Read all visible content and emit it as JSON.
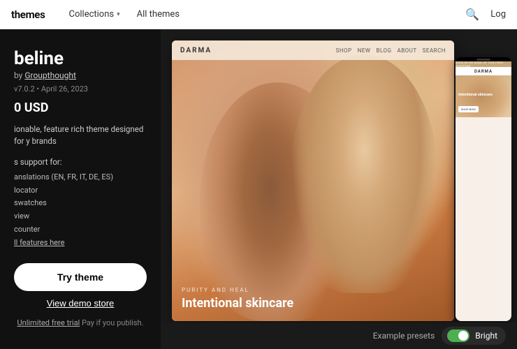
{
  "nav": {
    "logo": "themes",
    "links": [
      {
        "label": "Collections",
        "hasChevron": true
      },
      {
        "label": "All themes",
        "hasChevron": false
      }
    ],
    "search_icon": "🔍",
    "login_label": "Log"
  },
  "theme": {
    "name": "beline",
    "by_label": "by",
    "author": "Groupthought",
    "version": "v7.0.2 • April 26, 2023",
    "price": "0 USD",
    "description": "ionable, feature rich theme designed for y brands",
    "features_label": "s support for:",
    "features": [
      "anslations (EN, FR, IT, DE, ES)",
      "locator",
      "swatches",
      "view",
      "counter",
      "ll features here"
    ],
    "features_link_label": "ll features here",
    "try_button": "Try theme",
    "demo_button": "View demo store",
    "free_trial": "Unlimited free trial",
    "free_trial_suffix": " Pay if you publish."
  },
  "preview": {
    "desktop": {
      "store_name": "DARMA",
      "nav_links": [
        "SHOP",
        "NEW",
        "BLOG",
        "ABOUT",
        "SEARCH"
      ],
      "hero_tagline": "PURITY AND HEAL",
      "hero_title": "Intentional skincare"
    },
    "mobile": {
      "store_name": "DARMA",
      "banner_text": "SIGN IN OR SIGN UP FOR FREE SHIPPING",
      "hero_title": "Intentional skincare",
      "shop_button": "SHOP NOW"
    }
  },
  "bottom_bar": {
    "presets_label": "Example presets",
    "preset_name": "Bright",
    "toggle_on": true
  }
}
